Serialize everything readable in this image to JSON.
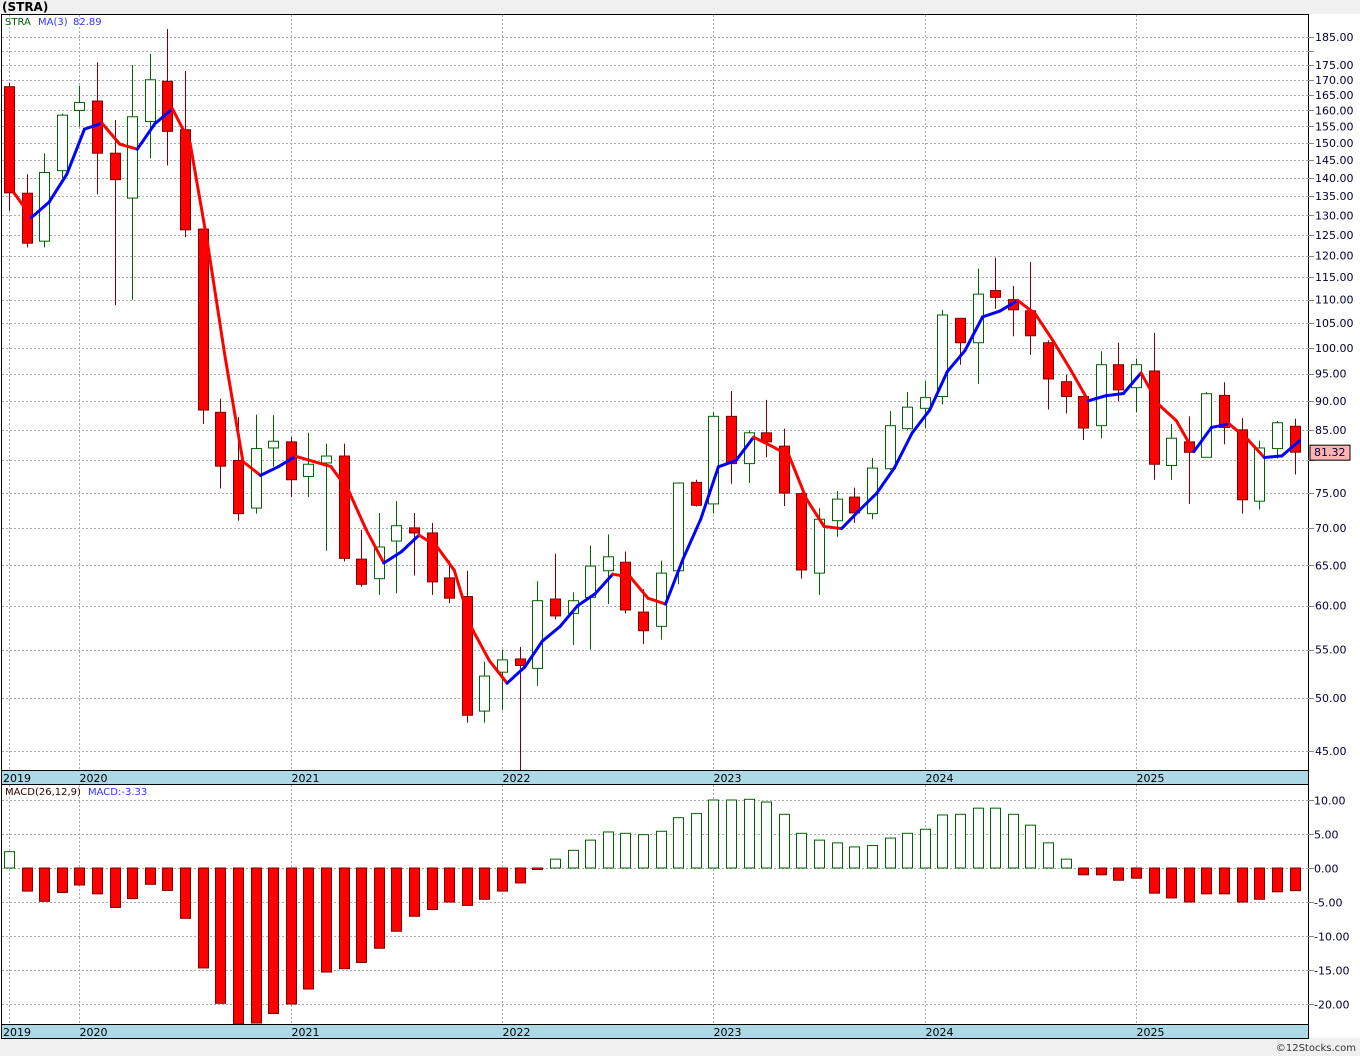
{
  "title": "(STRA)",
  "legend": {
    "symbol": "STRA",
    "ma_label": "MA(3)",
    "ma_value": "82.89"
  },
  "macd_legend": {
    "label": "MACD(26,12,9)",
    "value": "MACD:-3.33"
  },
  "last_price": "81.32",
  "footer": "©12Stocks.com",
  "colors": {
    "up_outline": "#006400",
    "down_fill": "#ff0000",
    "down_outline": "#800000",
    "ma_rising": "#0000ff",
    "ma_falling": "#ff0000",
    "axis_band": "#add8e6",
    "last_price_bg": "#ffb3b3"
  },
  "chart_data": [
    {
      "type": "candlestick",
      "title": "(STRA)",
      "frequency": "monthly",
      "y_scale": "log",
      "ylim": [
        43,
        190
      ],
      "grid": true,
      "year_labels": [
        "2019",
        "2020",
        "2021",
        "2022",
        "2023",
        "2024",
        "2025"
      ],
      "y_ticks": [
        "185.00",
        "175.00",
        "170.00",
        "165.00",
        "160.00",
        "155.00",
        "150.00",
        "145.00",
        "140.00",
        "135.00",
        "130.00",
        "125.00",
        "120.00",
        "115.00",
        "110.00",
        "105.00",
        "100.00",
        "95.00",
        "90.00",
        "85.00",
        "75.00",
        "70.00",
        "65.00",
        "60.00",
        "55.00",
        "50.00",
        "45.00"
      ],
      "overlay": {
        "name": "MA(3)",
        "period": 3
      },
      "ohlc_fields": [
        "open",
        "high",
        "low",
        "close"
      ],
      "ohlc": [
        [
          167.7,
          169,
          131.2,
          135.9
        ],
        [
          135.8,
          141,
          122,
          123
        ],
        [
          123.5,
          147,
          122,
          141.5
        ],
        [
          142,
          159,
          140,
          158.5
        ],
        [
          160,
          168,
          155,
          162.5
        ],
        [
          163,
          176,
          135.5,
          147
        ],
        [
          147,
          157,
          108.8,
          139.5
        ],
        [
          134.5,
          175,
          110,
          158
        ],
        [
          156.5,
          179,
          145.5,
          170
        ],
        [
          169.5,
          188,
          143.5,
          153.5
        ],
        [
          154,
          173,
          124.5,
          126.3
        ],
        [
          126.5,
          126.5,
          86,
          88.4
        ],
        [
          88,
          90.4,
          75.7,
          79.1
        ],
        [
          80,
          87.2,
          71,
          72
        ],
        [
          72.8,
          87.6,
          72,
          81.9
        ],
        [
          82,
          87.5,
          79,
          83.1
        ],
        [
          83,
          83.8,
          74.4,
          77
        ],
        [
          77.5,
          84.5,
          74.4,
          79.4
        ],
        [
          79.6,
          82.7,
          66.9,
          80.7
        ],
        [
          80.7,
          82.7,
          65.5,
          65.9
        ],
        [
          65.8,
          69.7,
          62.3,
          62.6
        ],
        [
          63.3,
          72.1,
          61.3,
          67.4
        ],
        [
          68.2,
          73.8,
          61.5,
          70.3
        ],
        [
          70,
          72.1,
          63.7,
          69.3
        ],
        [
          69.3,
          70.7,
          61.3,
          62.9
        ],
        [
          63.4,
          65.6,
          60.3,
          60.9
        ],
        [
          61.1,
          64.3,
          47.6,
          48.3
        ],
        [
          48.7,
          53.7,
          47.6,
          52.2
        ],
        [
          52.6,
          55,
          48.8,
          53.9
        ],
        [
          54,
          55.3,
          43.3,
          53.3
        ],
        [
          53,
          63,
          51.2,
          60.6
        ],
        [
          60.8,
          66.5,
          58.4,
          58.8
        ],
        [
          59.1,
          61.6,
          55.5,
          60.6
        ],
        [
          61,
          67.6,
          55,
          64.9
        ],
        [
          64.3,
          69.1,
          60.2,
          66.1
        ],
        [
          65.4,
          66.8,
          59.1,
          59.5
        ],
        [
          59.25,
          62,
          55.6,
          57.1
        ],
        [
          57.6,
          65.6,
          56.1,
          64
        ],
        [
          64.3,
          76.6,
          62.6,
          76.5
        ],
        [
          76.6,
          77,
          73,
          73.2
        ],
        [
          73.4,
          88,
          72,
          87.3
        ],
        [
          87.3,
          91.8,
          76.4,
          79.5
        ],
        [
          79.5,
          84.9,
          76.5,
          84.5
        ],
        [
          84.5,
          90.2,
          80.5,
          83
        ],
        [
          82.3,
          85.2,
          73.1,
          75
        ],
        [
          74.9,
          75.1,
          63.3,
          64.4
        ],
        [
          64,
          72.8,
          61.3,
          71.2
        ],
        [
          71,
          75.3,
          68.8,
          74.1
        ],
        [
          74.4,
          75.8,
          70.7,
          72.1
        ],
        [
          72,
          80.4,
          71.2,
          78.8
        ],
        [
          78.7,
          88.2,
          78.5,
          85.7
        ],
        [
          85.2,
          91.6,
          85,
          88.9
        ],
        [
          88.7,
          93.6,
          85.3,
          90.6
        ],
        [
          90.8,
          107.8,
          89.4,
          106.7
        ],
        [
          106,
          106,
          96.7,
          101
        ],
        [
          101,
          117,
          93.1,
          111.2
        ],
        [
          112,
          119.5,
          108,
          110.5
        ],
        [
          110,
          113,
          102.3,
          107.8
        ],
        [
          107.6,
          118.5,
          98.6,
          102.4
        ],
        [
          101,
          101.5,
          88.5,
          94
        ],
        [
          93.5,
          94.8,
          87.8,
          90.8
        ],
        [
          90.8,
          90.8,
          83.3,
          85.3
        ],
        [
          85.7,
          99.3,
          83.6,
          96.7
        ],
        [
          96.7,
          101,
          90,
          92
        ],
        [
          92.4,
          97.9,
          88,
          96.7
        ],
        [
          95.5,
          103,
          77,
          79.4
        ],
        [
          79.2,
          86,
          77,
          83.6
        ],
        [
          83,
          87.3,
          73.4,
          81.3
        ],
        [
          80.5,
          91.6,
          80.5,
          91.3
        ],
        [
          91,
          93.4,
          82.6,
          85.4
        ],
        [
          85,
          87,
          72,
          74
        ],
        [
          73.8,
          83.2,
          72.6,
          82
        ],
        [
          81.9,
          86.5,
          80.3,
          86.2
        ],
        [
          85.6,
          86.9,
          77.8,
          81.32
        ]
      ]
    },
    {
      "type": "bar",
      "title": "MACD(26,12,9)",
      "ylim": [
        -23.5,
        11.5
      ],
      "grid": true,
      "y_ticks": [
        "10.00",
        "5.00",
        "0.00",
        "-5.00",
        "-10.00",
        "-15.00",
        "-20.00"
      ],
      "year_labels": [
        "2019",
        "2020",
        "2021",
        "2022",
        "2023",
        "2024",
        "2025"
      ],
      "values": [
        2.4,
        -3.4,
        -4.9,
        -3.6,
        -2.5,
        -3.8,
        -5.8,
        -4.5,
        -2.4,
        -3.3,
        -7.4,
        -14.7,
        -19.9,
        -23.5,
        -22.8,
        -21.4,
        -20.0,
        -17.8,
        -15.3,
        -14.8,
        -13.9,
        -11.8,
        -9.3,
        -7.1,
        -6.1,
        -5.0,
        -5.5,
        -4.6,
        -3.4,
        -2.2,
        -0.15,
        1.3,
        2.6,
        4.1,
        5.3,
        5.1,
        4.9,
        5.4,
        7.4,
        8.0,
        10.0,
        10.0,
        10.1,
        9.7,
        7.9,
        5.1,
        4.1,
        3.7,
        3.1,
        3.3,
        4.4,
        5.1,
        5.7,
        7.8,
        7.9,
        8.8,
        8.8,
        7.9,
        6.3,
        3.7,
        1.3,
        -1.0,
        -1.0,
        -1.8,
        -1.5,
        -3.7,
        -4.4,
        -5.0,
        -3.8,
        -3.8,
        -5.0,
        -4.6,
        -3.5,
        -3.33
      ]
    }
  ]
}
